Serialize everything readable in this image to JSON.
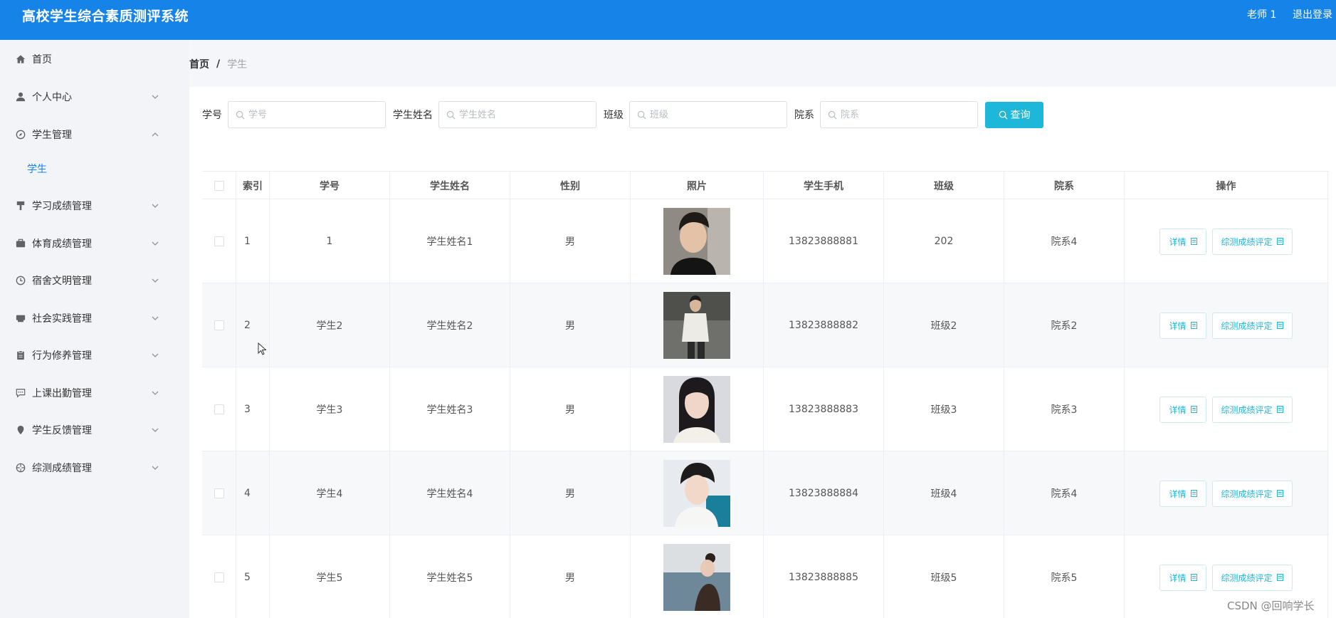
{
  "app": {
    "title": "高校学生综合素质测评系统",
    "user": "老师 1",
    "logout": "退出登录"
  },
  "sidebar": {
    "items": [
      {
        "label": "首页",
        "icon": "home-icon"
      },
      {
        "label": "个人中心",
        "icon": "user-icon"
      },
      {
        "label": "学生管理",
        "icon": "compass-icon",
        "expanded": true
      },
      {
        "label": "学习成绩管理",
        "icon": "brush-icon"
      },
      {
        "label": "体育成绩管理",
        "icon": "briefcase-icon"
      },
      {
        "label": "宿舍文明管理",
        "icon": "clock-icon"
      },
      {
        "label": "社会实践管理",
        "icon": "printer-icon"
      },
      {
        "label": "行为修养管理",
        "icon": "clipboard-icon"
      },
      {
        "label": "上课出勤管理",
        "icon": "chat-icon"
      },
      {
        "label": "学生反馈管理",
        "icon": "location-icon"
      },
      {
        "label": "综测成绩管理",
        "icon": "aperture-icon"
      }
    ],
    "sub_item": "学生"
  },
  "breadcrumb": {
    "home": "首页",
    "sep": "/",
    "current": "学生"
  },
  "search": {
    "fields": [
      {
        "label": "学号",
        "placeholder": "学号"
      },
      {
        "label": "学生姓名",
        "placeholder": "学生姓名"
      },
      {
        "label": "班级",
        "placeholder": "班级"
      },
      {
        "label": "院系",
        "placeholder": "院系"
      }
    ],
    "button": "查询"
  },
  "table": {
    "headers": {
      "index": "索引",
      "id": "学号",
      "name": "学生姓名",
      "gender": "性别",
      "photo": "照片",
      "phone": "学生手机",
      "class": "班级",
      "dept": "院系",
      "ops": "操作"
    },
    "rows": [
      {
        "index": "1",
        "id": "1",
        "name": "学生姓名1",
        "gender": "男",
        "phone": "13823888881",
        "class": "202",
        "dept": "院系4"
      },
      {
        "index": "2",
        "id": "学生2",
        "name": "学生姓名2",
        "gender": "男",
        "phone": "13823888882",
        "class": "班级2",
        "dept": "院系2"
      },
      {
        "index": "3",
        "id": "学生3",
        "name": "学生姓名3",
        "gender": "男",
        "phone": "13823888883",
        "class": "班级3",
        "dept": "院系3"
      },
      {
        "index": "4",
        "id": "学生4",
        "name": "学生姓名4",
        "gender": "男",
        "phone": "13823888884",
        "class": "班级4",
        "dept": "院系4"
      },
      {
        "index": "5",
        "id": "学生5",
        "name": "学生姓名5",
        "gender": "男",
        "phone": "13823888885",
        "class": "班级5",
        "dept": "院系5"
      }
    ],
    "detail_label": "详情",
    "evaluate_label": "综测成绩评定"
  },
  "watermark": "CSDN @回响学长",
  "colors": {
    "header": "#1583e8",
    "accent": "#1cb7d9"
  }
}
